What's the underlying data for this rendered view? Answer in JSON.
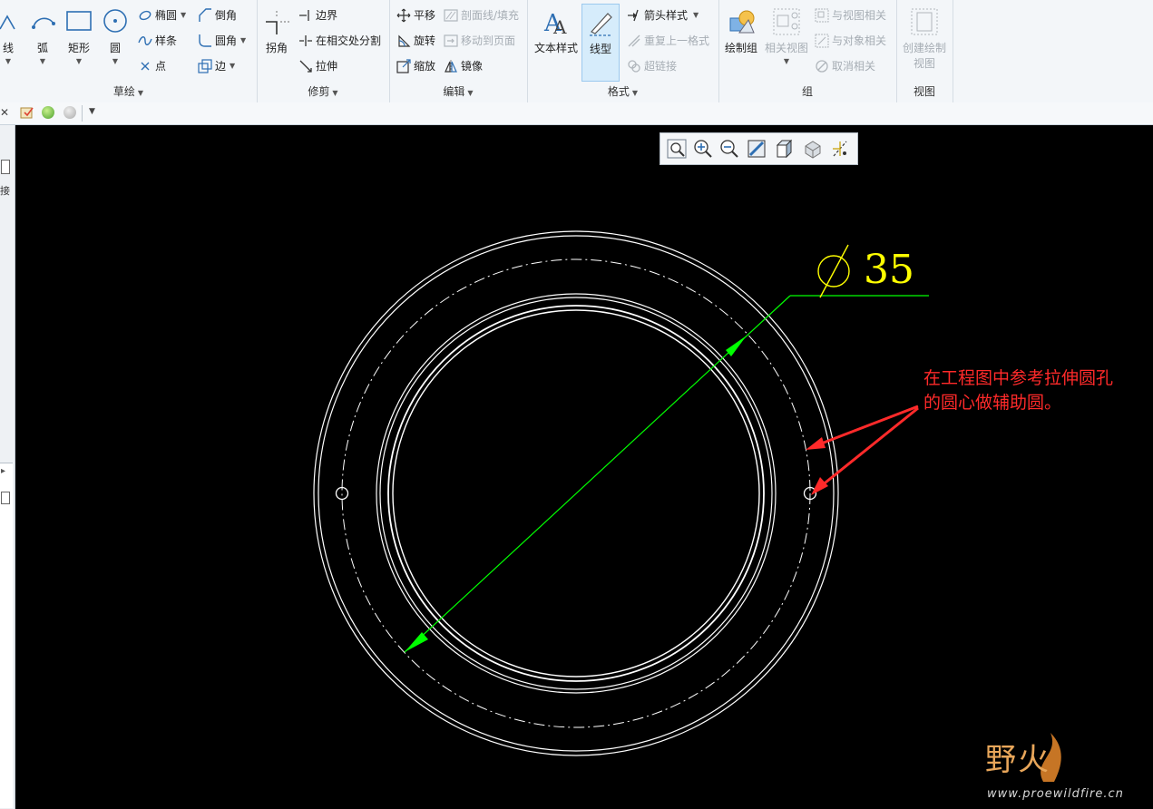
{
  "ribbon": {
    "sketch": {
      "label": "草绘",
      "line": "线",
      "arc": "弧",
      "rect": "矩形",
      "circle": "圆",
      "ellipse": "椭圆",
      "spline": "样条",
      "point": "点",
      "chamfer": "倒角",
      "fillet": "圆角",
      "edge": "边"
    },
    "trim": {
      "label": "修剪",
      "corner": "拐角",
      "boundary": "边界",
      "divide": "在相交处分割",
      "stretch": "拉伸"
    },
    "edit": {
      "label": "编辑",
      "translate": "平移",
      "rotate": "旋转",
      "scale": "缩放",
      "hatch": "剖面线/填充",
      "move_page": "移动到页面",
      "mirror": "镜像"
    },
    "format": {
      "label": "格式",
      "text_style": "文本样式",
      "line_style": "线型",
      "arrow_style": "箭头样式",
      "repeat_format": "重复上一格式",
      "hyperlink": "超链接"
    },
    "group": {
      "label": "组",
      "draw_group": "绘制组",
      "related_view": "相关视图",
      "view_related": "与视图相关",
      "object_related": "与对象相关",
      "unrelate": "取消相关"
    },
    "view": {
      "label": "视图",
      "create_view_l1": "创建绘制",
      "create_view_l2": "视图"
    }
  },
  "sidebar": {
    "text": "接"
  },
  "drawing": {
    "dimension_value": "35",
    "annotation_line1": "在工程图中参考拉伸圆孔",
    "annotation_line2": "的圆心做辅助圆。",
    "colors": {
      "geometry": "#ffffff",
      "dimension": "#00ff00",
      "diameter_text": "#ffff00",
      "annotation": "#ff2a2a"
    }
  },
  "watermark": {
    "text": "野火",
    "url": "www.proewildfire.cn"
  },
  "view_toolbar": {
    "icons": [
      "refit-icon",
      "zoom-in-icon",
      "zoom-out-icon",
      "repaint-icon",
      "display-style-icon",
      "saved-views-icon",
      "datum-display-icon"
    ]
  }
}
